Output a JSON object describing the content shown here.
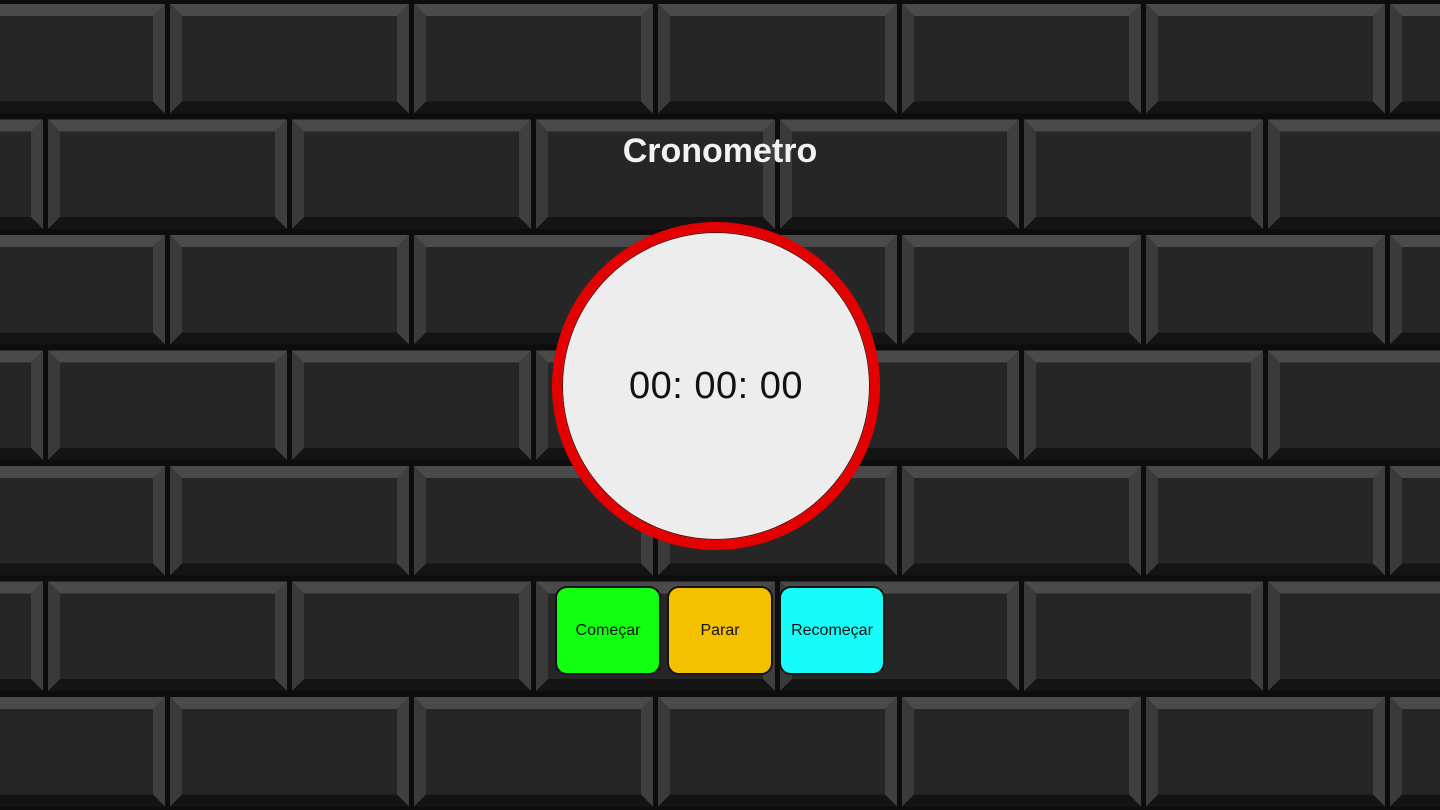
{
  "app": {
    "title": "Cronometro"
  },
  "stopwatch": {
    "display": "00: 00: 00"
  },
  "controls": {
    "start_label": "Começar",
    "stop_label": "Parar",
    "reset_label": "Recomeçar"
  },
  "colors": {
    "background": "#0d0d0d",
    "brick_face": "#262626",
    "clock_face": "#ededed",
    "clock_ring": "#e30000",
    "start_button": "#11ff11",
    "stop_button": "#f4c100",
    "reset_button": "#16fcf8",
    "title_text": "#f2f2f2"
  }
}
